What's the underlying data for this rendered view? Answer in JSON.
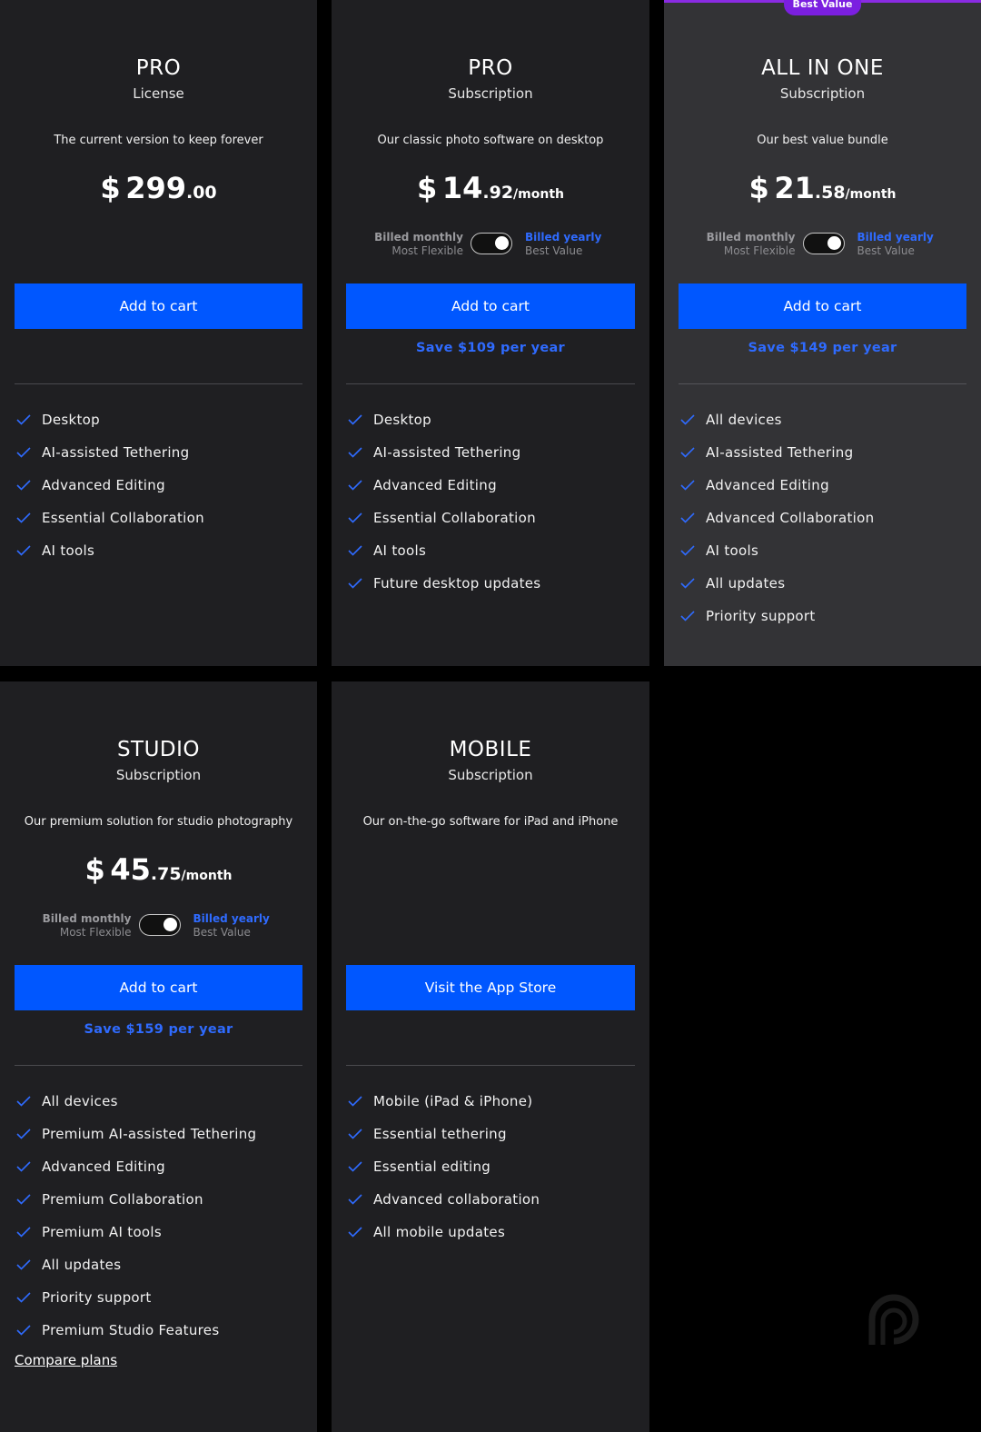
{
  "colors": {
    "accent": "#0057ff",
    "link": "#2f6bff",
    "ribbon": "#7b1fe0",
    "card": "#1f1f22",
    "card_highlight": "#333336"
  },
  "cards": [
    {
      "title": "PRO",
      "subtitle": "License",
      "description": "The current version to keep forever",
      "price": {
        "currency": "$",
        "integer": "299",
        "decimal": ".00",
        "period": ""
      },
      "cta": "Add to cart",
      "features": [
        "Desktop",
        "AI-assisted Tethering",
        "Advanced Editing",
        "Essential Collaboration",
        "AI tools"
      ]
    },
    {
      "title": "PRO",
      "subtitle": "Subscription",
      "description": "Our classic photo software on desktop",
      "price": {
        "currency": "$",
        "integer": "14",
        "decimal": ".92",
        "period": "/month"
      },
      "billing": {
        "monthly": "Billed monthly",
        "monthly_sub": "Most Flexible",
        "yearly": "Billed yearly",
        "yearly_sub": "Best Value"
      },
      "cta": "Add to cart",
      "save": "Save $109 per year",
      "features": [
        "Desktop",
        "AI-assisted Tethering",
        "Advanced Editing",
        "Essential Collaboration",
        "AI tools",
        "Future desktop updates"
      ]
    },
    {
      "ribbon": "Best Value",
      "title": "ALL IN ONE",
      "subtitle": "Subscription",
      "description": "Our best value bundle",
      "price": {
        "currency": "$",
        "integer": "21",
        "decimal": ".58",
        "period": "/month"
      },
      "billing": {
        "monthly": "Billed monthly",
        "monthly_sub": "Most Flexible",
        "yearly": "Billed yearly",
        "yearly_sub": "Best Value"
      },
      "cta": "Add to cart",
      "save": "Save $149 per year",
      "features": [
        "All devices",
        "AI-assisted Tethering",
        "Advanced Editing",
        "Advanced Collaboration",
        "AI tools",
        "All updates",
        "Priority support"
      ]
    },
    {
      "title": "STUDIO",
      "subtitle": "Subscription",
      "description": "Our premium solution for studio photography",
      "price": {
        "currency": "$",
        "integer": "45",
        "decimal": ".75",
        "period": "/month"
      },
      "billing": {
        "monthly": "Billed monthly",
        "monthly_sub": "Most Flexible",
        "yearly": "Billed yearly",
        "yearly_sub": "Best Value"
      },
      "cta": "Add to cart",
      "save": "Save $159 per year",
      "features": [
        "All devices",
        "Premium AI-assisted Tethering",
        "Advanced Editing",
        "Premium Collaboration",
        "Premium AI tools",
        "All updates",
        "Priority support",
        "Premium Studio Features"
      ]
    },
    {
      "title": "MOBILE",
      "subtitle": "Subscription",
      "description": "Our on-the-go software for iPad and iPhone",
      "cta": "Visit the App Store",
      "features": [
        "Mobile (iPad & iPhone)",
        "Essential tethering",
        "Essential editing",
        "Advanced collaboration",
        "All mobile updates"
      ]
    }
  ],
  "compare_link": "Compare plans"
}
